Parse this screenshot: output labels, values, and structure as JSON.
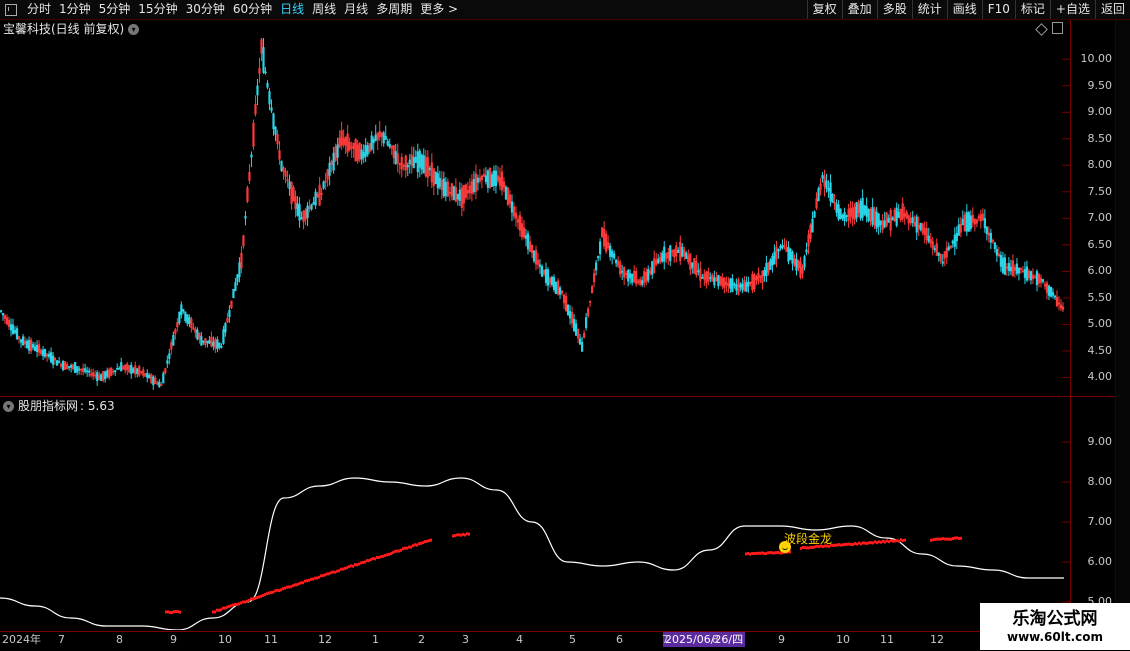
{
  "toolbar": {
    "periods": [
      "分时",
      "1分钟",
      "5分钟",
      "15分钟",
      "30分钟",
      "60分钟",
      "日线",
      "周线",
      "月线",
      "多周期",
      "更多 >"
    ],
    "active_period": "日线",
    "right_buttons": [
      "复权",
      "叠加",
      "多股",
      "统计",
      "画线",
      "F10",
      "标记",
      "+自选",
      "返回"
    ]
  },
  "stock": {
    "title": "宝馨科技(日线 前复权)"
  },
  "indicator": {
    "name": "股朋指标网",
    "value_label": ": 5.63",
    "signal_text": "波段金龙"
  },
  "watermark": {
    "line1": "乐淘公式网",
    "line2": "www.60lt.com"
  },
  "colors": {
    "up": "#ff3b3b",
    "down": "#2ad4e6",
    "grid_red": "#7a0000",
    "indicator_line": "#ffffff",
    "indicator_dots": "#ff1a1a",
    "active_tab": "#35d6ff",
    "date_highlight": "#5b2ba0"
  },
  "price_axis": {
    "ticks": [
      "10.00",
      "9.50",
      "9.00",
      "8.50",
      "8.00",
      "7.50",
      "7.00",
      "6.50",
      "6.00",
      "5.50",
      "5.00",
      "4.50",
      "4.00"
    ],
    "ylim": [
      3.65,
      10.4
    ]
  },
  "indicator_axis": {
    "ticks": [
      "9.00",
      "8.00",
      "7.00",
      "6.00",
      "5.00"
    ],
    "ylim": [
      4.3,
      9.7
    ]
  },
  "date_axis": {
    "labels": [
      "2024年",
      "7",
      "8",
      "9",
      "10",
      "11",
      "12",
      "1",
      "2",
      "3",
      "4",
      "5",
      "6",
      "7",
      "8",
      "9",
      "10",
      "11",
      "12"
    ],
    "selected_date": "2025/06/26/四"
  },
  "chart_data": {
    "type": "candlestick",
    "title": "宝馨科技(日线 前复权)",
    "close_anchors_x_index": [
      0,
      10,
      20,
      30,
      40,
      50,
      60,
      70,
      80,
      90,
      100,
      110,
      120,
      130,
      140,
      150,
      160,
      170,
      180,
      190,
      200,
      210,
      220,
      230,
      240,
      250,
      260,
      270,
      280,
      290,
      300,
      310,
      320,
      330,
      340,
      350,
      360,
      370,
      380,
      390,
      400,
      410,
      420,
      430,
      440,
      450,
      460,
      470,
      480,
      490,
      500,
      510,
      520,
      530
    ],
    "close_anchors": [
      5.25,
      4.7,
      4.5,
      4.25,
      4.15,
      4.0,
      4.2,
      4.1,
      3.85,
      5.3,
      4.7,
      4.6,
      6.2,
      10.2,
      8.0,
      7.0,
      7.5,
      8.5,
      8.2,
      8.6,
      8.0,
      8.1,
      7.6,
      7.4,
      7.8,
      7.7,
      6.8,
      6.0,
      5.6,
      4.6,
      6.7,
      6.0,
      5.8,
      6.3,
      6.4,
      5.9,
      5.8,
      5.7,
      5.9,
      6.5,
      6.0,
      7.8,
      7.0,
      7.2,
      6.9,
      7.1,
      6.8,
      6.2,
      6.9,
      7.0,
      6.1,
      6.0,
      5.8,
      5.3
    ],
    "n_bars": 531,
    "indicator_line_anchors": [
      5.1,
      4.9,
      4.6,
      4.4,
      4.4,
      4.3,
      4.6,
      5.0,
      7.6,
      7.9,
      8.1,
      8.0,
      7.9,
      8.1,
      7.8,
      7.0,
      6.0,
      5.9,
      6.0,
      5.8,
      6.3,
      6.9,
      6.9,
      6.8,
      6.9,
      6.6,
      6.2,
      5.9,
      5.8,
      5.6,
      5.6
    ],
    "indicator_dot_segments": [
      {
        "from": 165,
        "to": 180,
        "from_value": 4.75,
        "to_value": 4.75
      },
      {
        "from": 212,
        "to": 430,
        "from_value": 4.75,
        "to_value": 6.55
      },
      {
        "from": 452,
        "to": 468,
        "from_value": 6.65,
        "to_value": 6.7
      },
      {
        "from": 745,
        "to": 790,
        "from_value": 6.2,
        "to_value": 6.25
      },
      {
        "from": 800,
        "to": 905,
        "from_value": 6.35,
        "to_value": 6.55
      },
      {
        "from": 930,
        "to": 960,
        "from_value": 6.55,
        "to_value": 6.6
      }
    ],
    "ylim_price": [
      3.65,
      10.4
    ],
    "ylim_indicator": [
      4.3,
      9.7
    ]
  }
}
